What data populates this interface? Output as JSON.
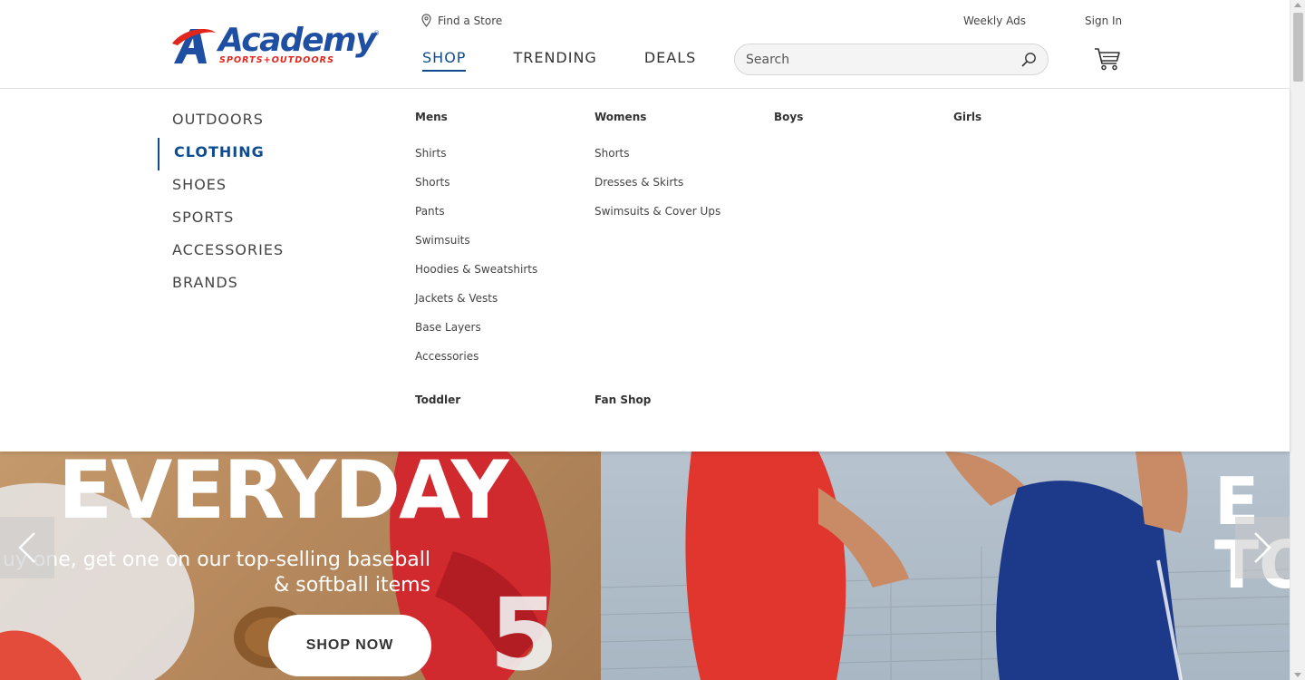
{
  "header": {
    "logo_word": "Academy",
    "logo_tagline": "SPORTS+OUTDOORS",
    "find_store": "Find a Store",
    "weekly_ads": "Weekly Ads",
    "sign_in": "Sign In",
    "nav": [
      {
        "label": "SHOP",
        "active": true
      },
      {
        "label": "TRENDING",
        "active": false
      },
      {
        "label": "DEALS",
        "active": false
      }
    ],
    "search_placeholder": "Search",
    "icons": {
      "store": "map-pin-icon",
      "search": "search-icon",
      "cart": "cart-icon"
    }
  },
  "mega_menu": {
    "categories": [
      "OUTDOORS",
      "CLOTHING",
      "SHOES",
      "SPORTS",
      "ACCESSORIES",
      "BRANDS"
    ],
    "active_category": "CLOTHING",
    "columns": {
      "mens": {
        "title": "Mens",
        "links": [
          "Shirts",
          "Shorts",
          "Pants",
          "Swimsuits",
          "Hoodies & Sweatshirts",
          "Jackets & Vests",
          "Base Layers",
          "Accessories"
        ]
      },
      "womens": {
        "title": "Womens",
        "links": [
          "Shorts",
          "Dresses & Skirts",
          "Swimsuits & Cover Ups"
        ]
      },
      "boys": {
        "title": "Boys"
      },
      "girls": {
        "title": "Girls"
      },
      "toddler": {
        "title": "Toddler"
      },
      "fan_shop": {
        "title": "Fan Shop"
      }
    }
  },
  "hero": {
    "headline": "EVERYDAY",
    "sub_line1": "uy one, get one on our top-selling baseball",
    "sub_line2": "& softball items",
    "cta": "SHOP NOW",
    "right_letters": "E\nTO"
  },
  "colors": {
    "brand_blue": "#0e4c92",
    "logo_blue": "#1f4fa3",
    "logo_red": "#e1251b"
  }
}
